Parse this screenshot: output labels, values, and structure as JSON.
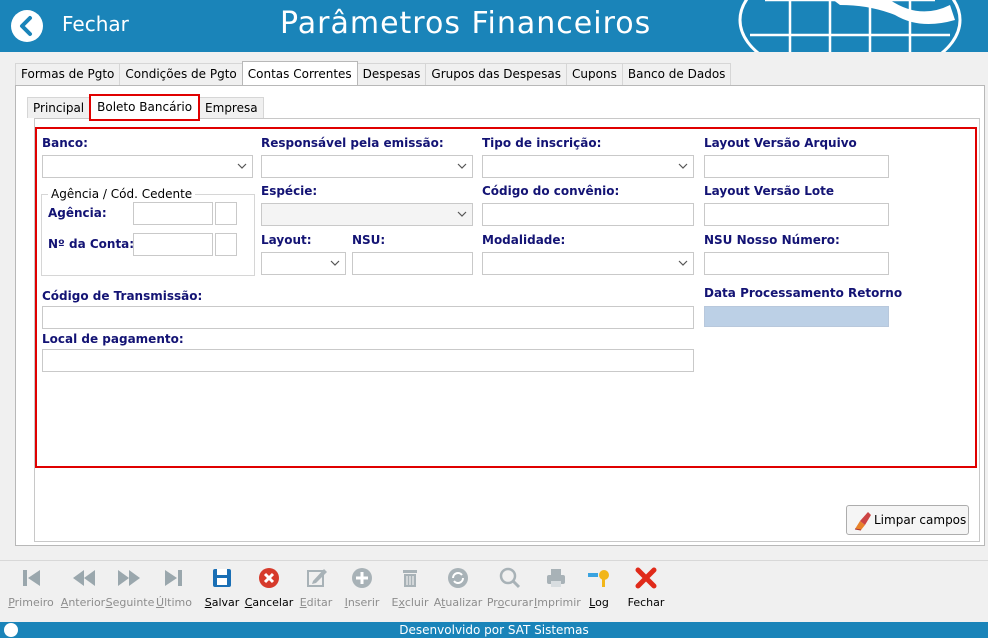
{
  "header": {
    "back_label": "Fechar",
    "title": "Parâmetros Financeiros"
  },
  "tabs": [
    {
      "label": "Formas de Pgto",
      "active": false
    },
    {
      "label": "Condições de Pgto",
      "active": false
    },
    {
      "label": "Contas Correntes",
      "active": true
    },
    {
      "label": "Despesas",
      "active": false
    },
    {
      "label": "Grupos das Despesas",
      "active": false
    },
    {
      "label": "Cupons",
      "active": false
    },
    {
      "label": "Banco de Dados",
      "active": false
    }
  ],
  "subtabs": [
    {
      "label": "Principal",
      "active": false
    },
    {
      "label": "Boleto Bancário",
      "active": true
    },
    {
      "label": "Empresa",
      "active": false
    }
  ],
  "form": {
    "banco": {
      "label": "Banco:",
      "value": ""
    },
    "agencia_group": {
      "title": "Agência / Cód. Cedente",
      "agencia_label": "Agência:",
      "conta_label": "Nº da Conta:"
    },
    "responsavel": {
      "label": "Responsável pela emissão:",
      "value": ""
    },
    "especie": {
      "label": "Espécie:",
      "value": ""
    },
    "layout": {
      "label": "Layout:",
      "value": ""
    },
    "nsu": {
      "label": "NSU:",
      "value": ""
    },
    "tipo_inscricao": {
      "label": "Tipo de inscrição:",
      "value": ""
    },
    "codigo_convenio": {
      "label": "Código do convênio:",
      "value": ""
    },
    "modalidade": {
      "label": "Modalidade:",
      "value": ""
    },
    "layout_versao_arquivo": {
      "label": "Layout Versão Arquivo",
      "value": ""
    },
    "layout_versao_lote": {
      "label": "Layout Versão Lote",
      "value": ""
    },
    "nsu_nosso_numero": {
      "label": "NSU Nosso Número:",
      "value": ""
    },
    "data_processamento": {
      "label": "Data Processamento Retorno",
      "value": ""
    },
    "codigo_transmissao": {
      "label": "Código de Transmissão:",
      "value": ""
    },
    "local_pagamento": {
      "label": "Local de pagamento:",
      "value": ""
    }
  },
  "limpar_button": "Limpar campos",
  "toolbar": [
    {
      "pre": "",
      "u": "P",
      "post": "rimeiro",
      "icon": "first-icon",
      "enabled": false
    },
    {
      "pre": "",
      "u": "A",
      "post": "nterior",
      "icon": "previous-icon",
      "enabled": false
    },
    {
      "pre": "",
      "u": "S",
      "post": "eguinte",
      "icon": "next-icon",
      "enabled": false
    },
    {
      "pre": "",
      "u": "Ú",
      "post": "ltimo",
      "icon": "last-icon",
      "enabled": false
    },
    {
      "pre": "",
      "u": "S",
      "post": "alvar",
      "icon": "save-icon",
      "enabled": true
    },
    {
      "pre": "",
      "u": "C",
      "post": "ancelar",
      "icon": "cancel-icon",
      "enabled": true
    },
    {
      "pre": "",
      "u": "E",
      "post": "ditar",
      "icon": "edit-icon",
      "enabled": false
    },
    {
      "pre": "",
      "u": "I",
      "post": "nserir",
      "icon": "insert-icon",
      "enabled": false
    },
    {
      "pre": "E",
      "u": "x",
      "post": "cluir",
      "icon": "delete-icon",
      "enabled": false
    },
    {
      "pre": "A",
      "u": "t",
      "post": "ualizar",
      "icon": "refresh-icon",
      "enabled": false
    },
    {
      "pre": "Pr",
      "u": "o",
      "post": "curar",
      "icon": "search-icon",
      "enabled": false
    },
    {
      "pre": "",
      "u": "I",
      "post": "mprimir",
      "icon": "print-icon",
      "enabled": false
    },
    {
      "pre": "",
      "u": "L",
      "post": "og",
      "icon": "log-key-icon",
      "enabled": true
    },
    {
      "pre": "",
      "u": "",
      "post": "Fechar",
      "icon": "close-icon",
      "enabled": true
    }
  ],
  "footer": "Desenvolvido por SAT Sistemas",
  "colors": {
    "header_bg": "#1a84b9",
    "label": "#131374",
    "highlight": "#e00000"
  }
}
